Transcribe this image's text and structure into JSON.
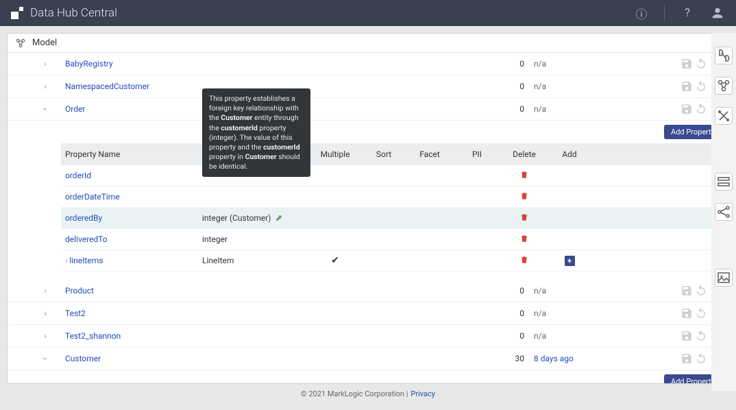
{
  "header": {
    "title": "Data Hub Central"
  },
  "panel": {
    "title": "Model"
  },
  "entities": [
    {
      "name": "BabyRegistry",
      "count": "0",
      "ts": "n/a",
      "chev": "right"
    },
    {
      "name": "NamespacedCustomer",
      "count": "0",
      "ts": "n/a",
      "chev": "right"
    },
    {
      "name": "Order",
      "count": "0",
      "ts": "n/a",
      "chev": "down"
    },
    {
      "name": "Product",
      "count": "0",
      "ts": "n/a",
      "chev": "right"
    },
    {
      "name": "Test2",
      "count": "0",
      "ts": "n/a",
      "chev": "right"
    },
    {
      "name": "Test2_shannon",
      "count": "0",
      "ts": "n/a",
      "chev": "right"
    },
    {
      "name": "Customer",
      "count": "30",
      "ts": "8 days ago",
      "chev": "down",
      "tslink": true
    }
  ],
  "prop_headers": {
    "name": "Property Name",
    "mult": "Multiple",
    "sort": "Sort",
    "facet": "Facet",
    "pii": "PII",
    "del": "Delete",
    "add": "Add"
  },
  "properties": [
    {
      "name": "orderId",
      "type": ""
    },
    {
      "name": "orderDateTime",
      "type": ""
    },
    {
      "name": "orderedBy",
      "type": "integer (Customer)",
      "fk": true,
      "hl": true
    },
    {
      "name": "deliveredTo",
      "type": "integer"
    },
    {
      "name": "lineItems",
      "type": "LineItem",
      "expand": true,
      "mult": true,
      "add": true
    }
  ],
  "tooltip": {
    "t1": "This property establishes a foreign key relationship with the ",
    "b1": "Customer",
    "t2": " entity through the ",
    "b2": "customerId",
    "t3": " property (integer). The value of this property and the ",
    "b3": "customerId",
    "t4": " property in ",
    "b4": "Customer",
    "t5": " should be identical."
  },
  "buttons": {
    "add_property": "Add Property"
  },
  "footer": {
    "copy": "© 2021 MarkLogic Corporation |",
    "privacy": "Privacy"
  }
}
